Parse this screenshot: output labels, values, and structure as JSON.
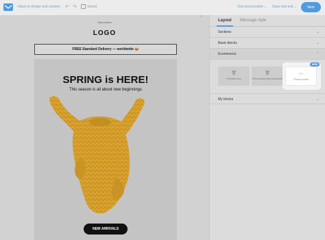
{
  "topbar": {
    "back_label": "Back to design and content",
    "saved_label": "Saved",
    "test_preview_label": "Test and preview",
    "save_exit_label": "Save and exit",
    "next_label": "Next"
  },
  "email": {
    "view_online": "View online",
    "logo": "LOGO",
    "delivery_banner": "FREE Standard Delivery — worldwide 📦",
    "hero_title": "SPRING is HERE!",
    "hero_subtitle": "This season is all about new beginnings",
    "cta_label": "NEW ARRIVALS"
  },
  "panel": {
    "tabs": [
      {
        "label": "Layout",
        "active": true
      },
      {
        "label": "Message style",
        "active": false
      }
    ],
    "sections": [
      {
        "label": "Sections"
      },
      {
        "label": "Basic blocks"
      },
      {
        "label": "Ecommerce"
      },
      {
        "label": "My blocks"
      }
    ],
    "ecommerce_blocks": [
      {
        "label": "Product box",
        "icon": "product-box-icon"
      },
      {
        "label": "Recommended products",
        "icon": "recommended-products-icon"
      },
      {
        "label": "Promo code",
        "icon": "promo-code-icon",
        "badge": "NEW"
      }
    ]
  },
  "colors": {
    "accent": "#4f9be0",
    "cta_bg": "#111111",
    "sweater": "#d9a22e"
  }
}
